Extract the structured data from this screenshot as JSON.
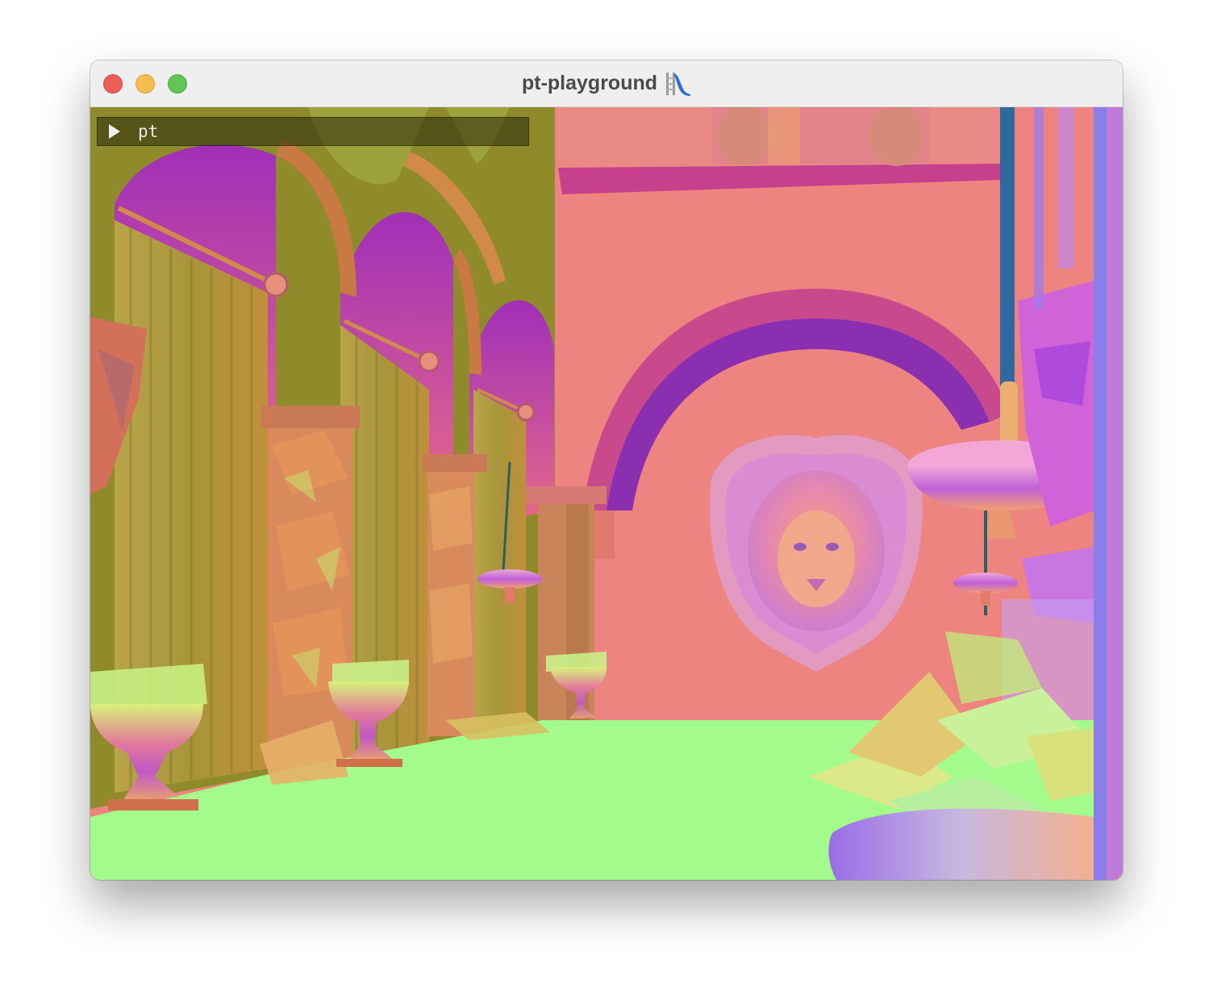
{
  "window": {
    "title": "pt-playground",
    "title_icon": "playground-slide-icon"
  },
  "overlay": {
    "menu_label": "pt",
    "menu_icon": "triangle-right-icon"
  },
  "scene": {
    "description_type": "normal-map render",
    "colors": {
      "wall": "#ee847f",
      "floor": "#a2fb8b",
      "olive": "#8f8a2a",
      "magenta": "#c43c9c",
      "purple": "#8a58e6"
    }
  }
}
